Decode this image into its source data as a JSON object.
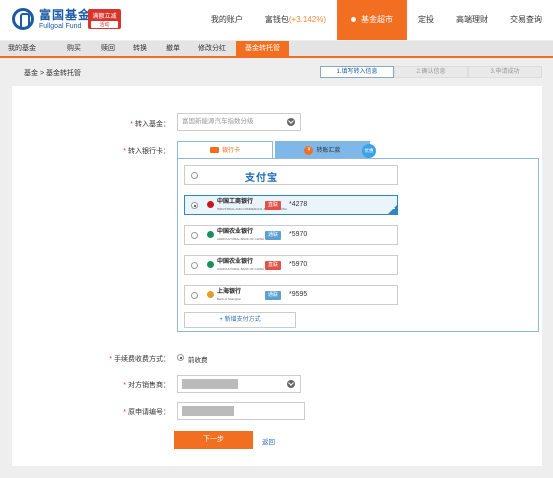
{
  "brand": {
    "name_cn": "富国基金",
    "name_en": "Fullgoal Fund",
    "promo_line1": "满额立减",
    "promo_line2": "活动"
  },
  "main_nav": [
    {
      "label": "我的账户"
    },
    {
      "label": "富钱包",
      "rate": "(+3.142%)"
    },
    {
      "label": "基金超市",
      "active": true
    },
    {
      "label": "定投"
    },
    {
      "label": "高端理财"
    },
    {
      "label": "交易查询"
    }
  ],
  "sub_nav": [
    "我的基金",
    "购买",
    "赎回",
    "转换",
    "撤单",
    "修改分红",
    "基金转托管"
  ],
  "breadcrumb": "基金 > 基金转托管",
  "steps": [
    "1.填写转入信息",
    "2.确认信息",
    "3.申请成功"
  ],
  "form": {
    "fund_label": "转入基金：",
    "fund_value": "富国新能源汽车指数分级",
    "bank_label": "转入银行卡：",
    "tab_bank": "银行卡",
    "tab_remit": "转账汇款",
    "tab_remit_badge": "优惠",
    "banks": [
      {
        "type": "alipay",
        "name": "支付宝"
      },
      {
        "name": "中国工商银行",
        "sub": "INDUSTRIAL AND COMMERCIAL BANK OF CHINA",
        "tag": "直联",
        "tag_color": "#e0534a",
        "tail": "*4278",
        "logo_color": "#c8161d",
        "selected": true
      },
      {
        "name": "中国农业银行",
        "sub": "AGRICULTURAL BANK OF CHINA",
        "tag": "通联",
        "tag_color": "#5aa0d0",
        "tail": "*5970",
        "logo_color": "#1a8f5e"
      },
      {
        "name": "中国农业银行",
        "sub": "AGRICULTURAL BANK OF CHINA",
        "tag": "直联",
        "tag_color": "#e0534a",
        "tail": "*5970",
        "logo_color": "#1a8f5e"
      },
      {
        "name": "上海银行",
        "sub": "Bank of Shanghai",
        "tag": "通联",
        "tag_color": "#5aa0d0",
        "tail": "*9595",
        "logo_color": "#e39b2a"
      }
    ],
    "new_payment": "+ 新增支付方式",
    "fee_label": "手续费收费方式：",
    "fee_value": "前收费",
    "seller_label": "对方销售商：",
    "seller_value": "",
    "app_no_label": "原申请编号：",
    "next_button": "下一步",
    "back_link": "返回"
  }
}
